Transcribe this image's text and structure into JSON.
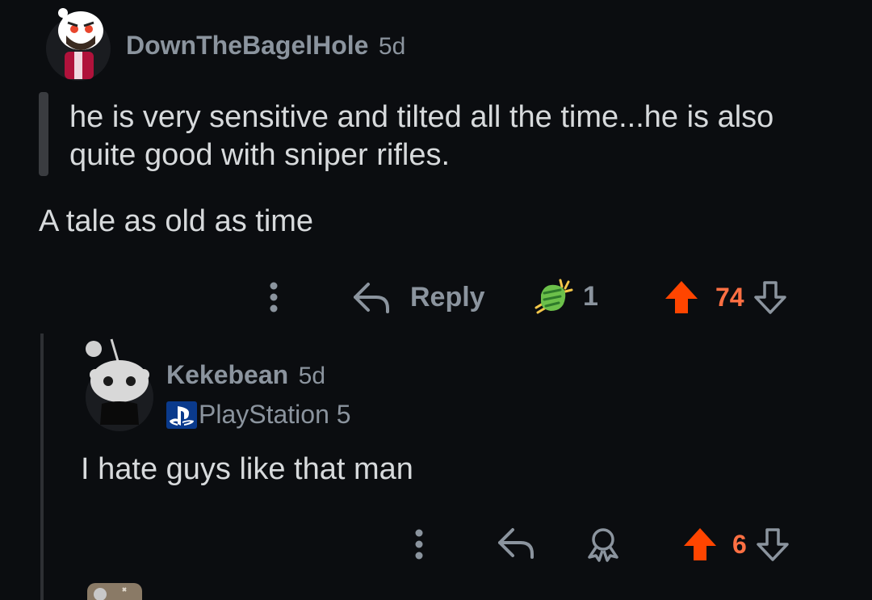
{
  "comment1": {
    "username": "DownTheBagelHole",
    "age": "5d",
    "quote": "he is very sensitive and tilted all the time...he is also quite good with sniper rifles.",
    "body": "A tale as old as time",
    "actions": {
      "reply_label": "Reply",
      "award_count": "1",
      "upvote_count": "74"
    }
  },
  "comment2": {
    "username": "Kekebean",
    "age": "5d",
    "flair": "PlayStation 5",
    "body": "I hate guys like that man",
    "actions": {
      "upvote_count": "6"
    }
  },
  "colors": {
    "background": "#0b0d10",
    "text": "#d7dadc",
    "muted": "#8b949e",
    "upvote": "#ff4500",
    "upvote_count": "#ff7043"
  },
  "icons": [
    "more-vertical-icon",
    "reply-icon",
    "award-icon",
    "upvote-icon",
    "downvote-icon",
    "playstation-icon"
  ]
}
